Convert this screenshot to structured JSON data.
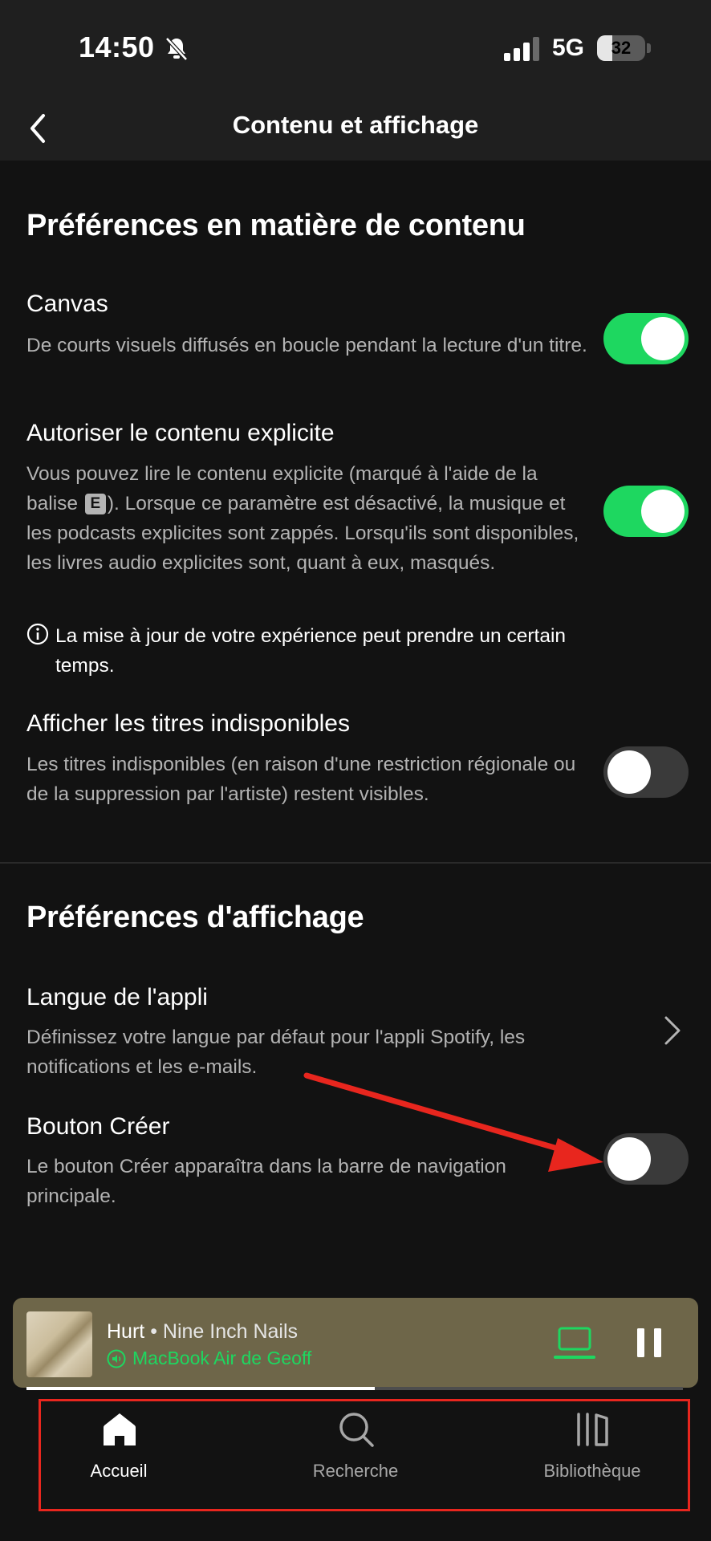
{
  "status_bar": {
    "time": "14:50",
    "network": "5G",
    "battery_level": "32",
    "battery_fraction": 0.32
  },
  "header": {
    "title": "Contenu et affichage"
  },
  "content_prefs": {
    "title": "Préférences en matière de contenu",
    "canvas": {
      "title": "Canvas",
      "description": "De courts visuels diffusés en boucle pendant la lecture d'un titre.",
      "enabled": true
    },
    "explicit": {
      "title": "Autoriser le contenu explicite",
      "description_part1": "Vous pouvez lire le contenu explicite (marqué à l'aide de la balise",
      "badge": "E",
      "description_part2": "). Lorsque ce paramètre est désactivé, la musique et les podcasts explicites sont zappés. Lorsqu'ils sont disponibles, les livres audio explicites sont, quant à eux, masqués.",
      "notice": "La mise à jour de votre expérience peut prendre un certain temps.",
      "enabled": true
    },
    "unavailable": {
      "title": "Afficher les titres indisponibles",
      "description": "Les titres indisponibles (en raison d'une restriction régionale ou de la suppression par l'artiste) restent visibles.",
      "enabled": false
    }
  },
  "display_prefs": {
    "title": "Préférences d'affichage",
    "language": {
      "title": "Langue de l'appli",
      "description": "Définissez votre langue par défaut pour l'appli Spotify, les notifications et les e-mails."
    },
    "create_button": {
      "title": "Bouton Créer",
      "description": "Le bouton Créer apparaîtra dans la barre de navigation principale.",
      "enabled": false
    }
  },
  "now_playing": {
    "song": "Hurt",
    "separator": "•",
    "artist": "Nine Inch Nails",
    "device": "MacBook Air de Geoff",
    "progress": 0.53
  },
  "tabs": [
    {
      "label": "Accueil",
      "icon": "home-icon",
      "active": true
    },
    {
      "label": "Recherche",
      "icon": "search-icon",
      "active": false
    },
    {
      "label": "Bibliothèque",
      "icon": "library-icon",
      "active": false
    }
  ],
  "colors": {
    "accent": "#1ed760",
    "background": "#121212",
    "player_bg": "#6e6649",
    "annotation": "#e8261e"
  }
}
